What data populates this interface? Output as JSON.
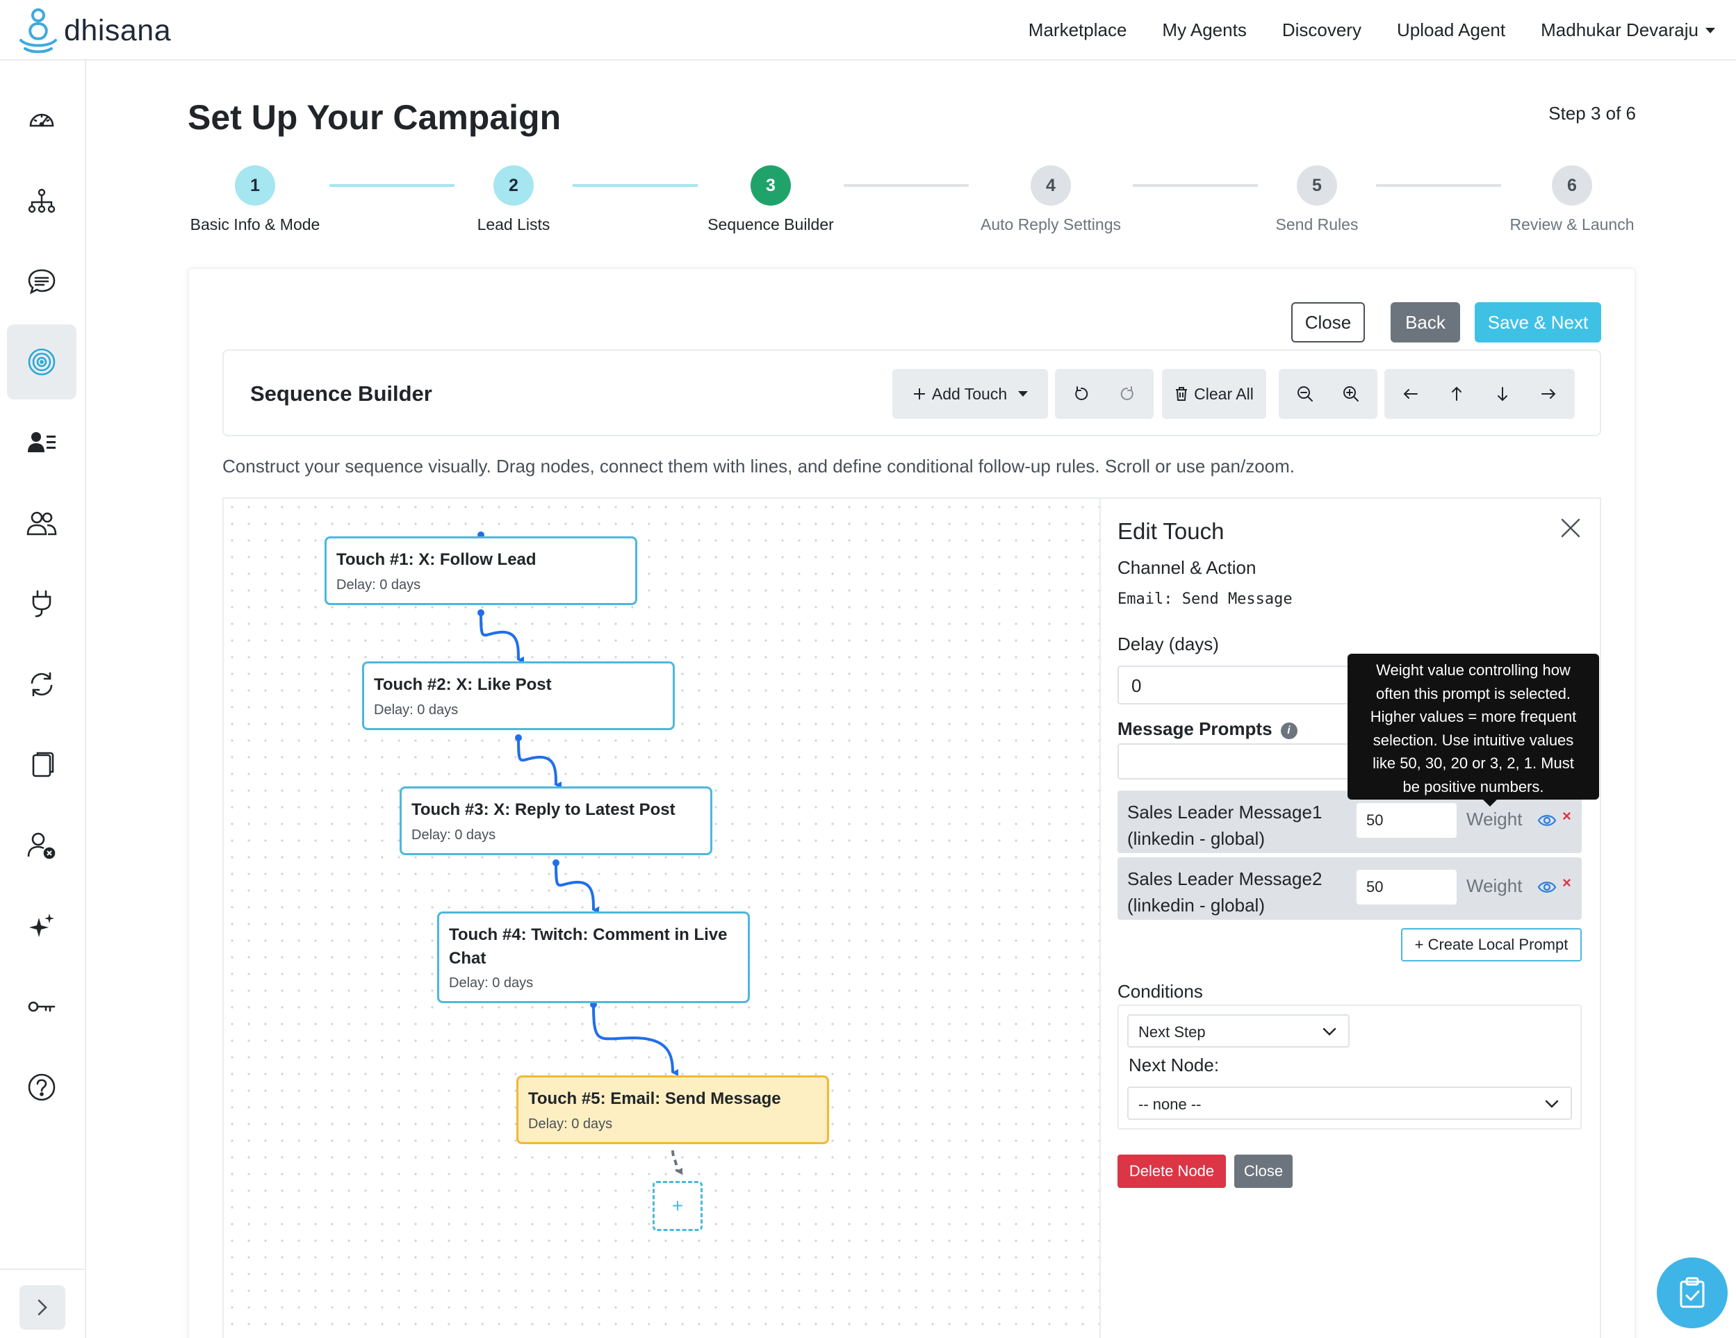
{
  "app": {
    "brand": "dhisana"
  },
  "nav": {
    "links": [
      "Marketplace",
      "My Agents",
      "Discovery",
      "Upload Agent"
    ],
    "user": "Madhukar Devaraju"
  },
  "sidebar": {
    "items": [
      {
        "icon": "dashboard-gauge-icon"
      },
      {
        "icon": "org-chart-icon"
      },
      {
        "icon": "chat-bubble-icon"
      },
      {
        "icon": "target-icon",
        "active": true
      },
      {
        "icon": "lead-list-icon"
      },
      {
        "icon": "people-icon"
      },
      {
        "icon": "plug-icon"
      },
      {
        "icon": "sync-icon"
      },
      {
        "icon": "copy-icon"
      },
      {
        "icon": "user-block-icon"
      },
      {
        "icon": "sparkles-icon"
      },
      {
        "icon": "key-icon"
      },
      {
        "icon": "help-icon"
      }
    ]
  },
  "page": {
    "title": "Set Up Your Campaign",
    "step_count": "Step 3 of 6"
  },
  "stepper": {
    "steps": [
      {
        "num": "1",
        "label": "Basic Info & Mode",
        "state": "done"
      },
      {
        "num": "2",
        "label": "Lead Lists",
        "state": "done"
      },
      {
        "num": "3",
        "label": "Sequence Builder",
        "state": "current"
      },
      {
        "num": "4",
        "label": "Auto Reply Settings",
        "state": "todo"
      },
      {
        "num": "5",
        "label": "Send Rules",
        "state": "todo"
      },
      {
        "num": "6",
        "label": "Review & Launch",
        "state": "todo"
      }
    ]
  },
  "actions": {
    "close": "Close",
    "back": "Back",
    "save_next": "Save & Next"
  },
  "builder": {
    "title": "Sequence Builder",
    "add_touch": "Add Touch",
    "clear_all": "Clear All",
    "description": "Construct your sequence visually. Drag nodes, connect them with lines, and define conditional follow-up rules. Scroll or use pan/zoom."
  },
  "nodes": [
    {
      "title": "Touch #1: X: Follow Lead",
      "delay": "Delay: 0 days"
    },
    {
      "title": "Touch #2: X: Like Post",
      "delay": "Delay: 0 days"
    },
    {
      "title": "Touch #3: X: Reply to Latest Post",
      "delay": "Delay: 0 days"
    },
    {
      "title": "Touch #4: Twitch: Comment in Live Chat",
      "delay": "Delay: 0 days"
    },
    {
      "title": "Touch #5: Email: Send Message",
      "delay": "Delay: 0 days",
      "selected": true
    }
  ],
  "add_node_label": "+",
  "edit": {
    "title": "Edit Touch",
    "channel_label": "Channel & Action",
    "channel_value": "Email: Send Message",
    "delay_label": "Delay (days)",
    "delay_value": "0",
    "prompts_label": "Message Prompts",
    "prompts": [
      {
        "name_line1": "Sales Leader Message1",
        "name_line2": "(linkedin - global)",
        "weight": "50"
      },
      {
        "name_line1": "Sales Leader Message2",
        "name_line2": "(linkedin - global)",
        "weight": "50"
      }
    ],
    "weight_label": "Weight",
    "create_prompt": "+ Create Local Prompt",
    "conditions_label": "Conditions",
    "condition_value": "Next Step",
    "next_node_label": "Next Node:",
    "next_node_value": "-- none --",
    "delete_node": "Delete Node",
    "close": "Close"
  },
  "tooltip": {
    "lines": [
      "Weight value controlling how",
      "often this prompt is selected.",
      "Higher values = more frequent",
      "selection. Use intuitive values",
      "like 50, 30, 20 or 3, 2, 1. Must",
      "be positive numbers."
    ]
  },
  "colors": {
    "accent_cyan": "#3fc1e6",
    "step_done": "#a5e6f0",
    "step_current": "#20a36b",
    "node_border": "#4db8dd",
    "node_selected": "#fdefc2",
    "edge_blue": "#1f6feb",
    "danger": "#dc3545"
  }
}
